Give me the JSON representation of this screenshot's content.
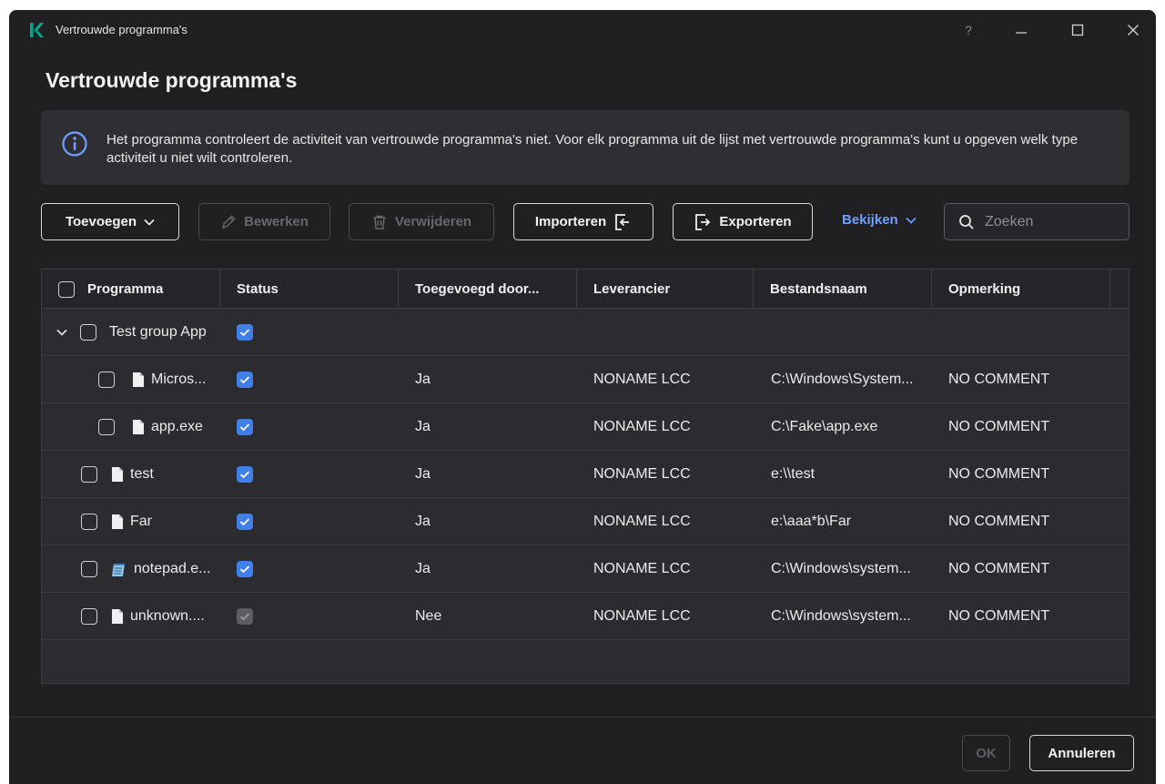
{
  "window": {
    "title": "Vertrouwde programma's",
    "help": "?"
  },
  "page": {
    "title": "Vertrouwde programma's"
  },
  "banner": {
    "text": "Het programma controleert de activiteit van vertrouwde programma's niet. Voor elk programma uit de lijst met vertrouwde programma's kunt u opgeven welk type activiteit u niet wilt controleren."
  },
  "toolbar": {
    "add": "Toevoegen",
    "edit": "Bewerken",
    "delete": "Verwijderen",
    "import": "Importeren",
    "export": "Exporteren",
    "view": "Bekijken",
    "search_placeholder": "Zoeken"
  },
  "table": {
    "columns": [
      "Programma",
      "Status",
      "Toegevoegd door...",
      "Leverancier",
      "Bestandsnaam",
      "Opmerking"
    ],
    "group": {
      "name": "Test group App",
      "status": "checked"
    },
    "rows": [
      {
        "program": "Micros...",
        "icon": "file-icon",
        "status": "checked",
        "added_by": "Ja",
        "vendor": "NONAME LCC",
        "filename": "C:\\Windows\\System...",
        "comment": "NO COMMENT",
        "level": 1
      },
      {
        "program": "app.exe",
        "icon": "file-icon",
        "status": "checked",
        "added_by": "Ja",
        "vendor": "NONAME LCC",
        "filename": "C:\\Fake\\app.exe",
        "comment": "NO COMMENT",
        "level": 1
      },
      {
        "program": "test",
        "icon": "file-icon",
        "status": "checked",
        "added_by": "Ja",
        "vendor": "NONAME LCC",
        "filename": "e:\\\\test",
        "comment": "NO COMMENT",
        "level": 0
      },
      {
        "program": "Far",
        "icon": "file-icon",
        "status": "checked",
        "added_by": "Ja",
        "vendor": "NONAME LCC",
        "filename": "e:\\aaa*b\\Far",
        "comment": "NO COMMENT",
        "level": 0
      },
      {
        "program": "notepad.e...",
        "icon": "notepad-icon",
        "status": "checked",
        "added_by": "Ja",
        "vendor": "NONAME LCC",
        "filename": "C:\\Windows\\system...",
        "comment": "NO COMMENT",
        "level": 0
      },
      {
        "program": "unknown....",
        "icon": "file-icon",
        "status": "checked-disabled",
        "added_by": "Nee",
        "vendor": "NONAME LCC",
        "filename": "C:\\Windows\\system...",
        "comment": "NO COMMENT",
        "level": 0
      }
    ]
  },
  "footer": {
    "ok": "OK",
    "cancel": "Annuleren"
  },
  "colors": {
    "accent": "#3f7fe6",
    "link": "#6ea0ff",
    "brand": "#00a88e",
    "background": "#202023"
  }
}
